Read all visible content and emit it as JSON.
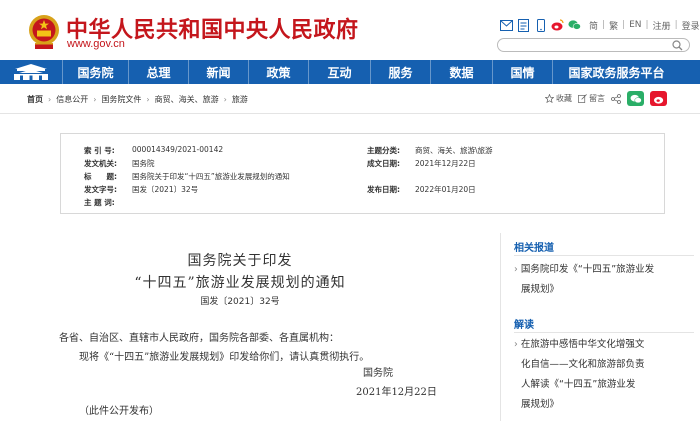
{
  "header": {
    "site_title": "中华人民共和国中央人民政府",
    "site_url": "www.gov.cn",
    "lang_simplified": "简",
    "lang_traditional": "繁",
    "lang_en": "EN",
    "register": "注册",
    "login": "登录",
    "search_placeholder": ""
  },
  "nav": {
    "items": [
      "国务院",
      "总理",
      "新闻",
      "政策",
      "互动",
      "服务",
      "数据",
      "国情",
      "国家政务服务平台"
    ]
  },
  "breadcrumb": {
    "items": [
      "首页",
      "信息公开",
      "国务院文件",
      "商贸、海关、旅游",
      "旅游"
    ],
    "collect": "收藏",
    "print": "留言"
  },
  "info": {
    "index_label": "索 引 号:",
    "index_value": "000014349/2021-00142",
    "category_label": "主题分类:",
    "category_value": "商贸、海关、旅游\\旅游",
    "issuer_label": "发文机关:",
    "issuer_value": "国务院",
    "date_written_label": "成文日期:",
    "date_written_value": "2021年12月22日",
    "title_label": "标　　题:",
    "title_value": "国务院关于印发“十四五”旅游业发展规划的通知",
    "doc_no_label": "发文字号:",
    "doc_no_value": "国发〔2021〕32号",
    "publish_date_label": "发布日期:",
    "publish_date_value": "2022年01月20日",
    "keywords_label": "主 题 词:",
    "keywords_value": ""
  },
  "article": {
    "title_line1": "国务院关于印发",
    "title_line2": "“十四五”旅游业发展规划的通知",
    "doc_number": "国发〔2021〕32号",
    "recipients": "各省、自治区、直辖市人民政府，国务院各部委、各直属机构：",
    "body": "现将《“十四五”旅游业发展规划》印发给你们，请认真贯彻执行。",
    "signer": "国务院",
    "date": "2021年12月22日",
    "note": "（此件公开发布）"
  },
  "sidebar": {
    "related_heading": "相关报道",
    "related_line1": "国务院印发《“十四五”旅游业发",
    "related_line2": "展规划》",
    "explain_heading": "解读",
    "explain_line1": "在旅游中感悟中华文化增强文",
    "explain_line2": "化自信——文化和旅游部负责",
    "explain_line3": "人解读《“十四五”旅游业发",
    "explain_line4": "展规划》"
  },
  "colors": {
    "brand_red": "#c4161c",
    "nav_blue": "#1660b0",
    "wechat_green": "#2aae67",
    "weibo_red": "#e6162d"
  }
}
